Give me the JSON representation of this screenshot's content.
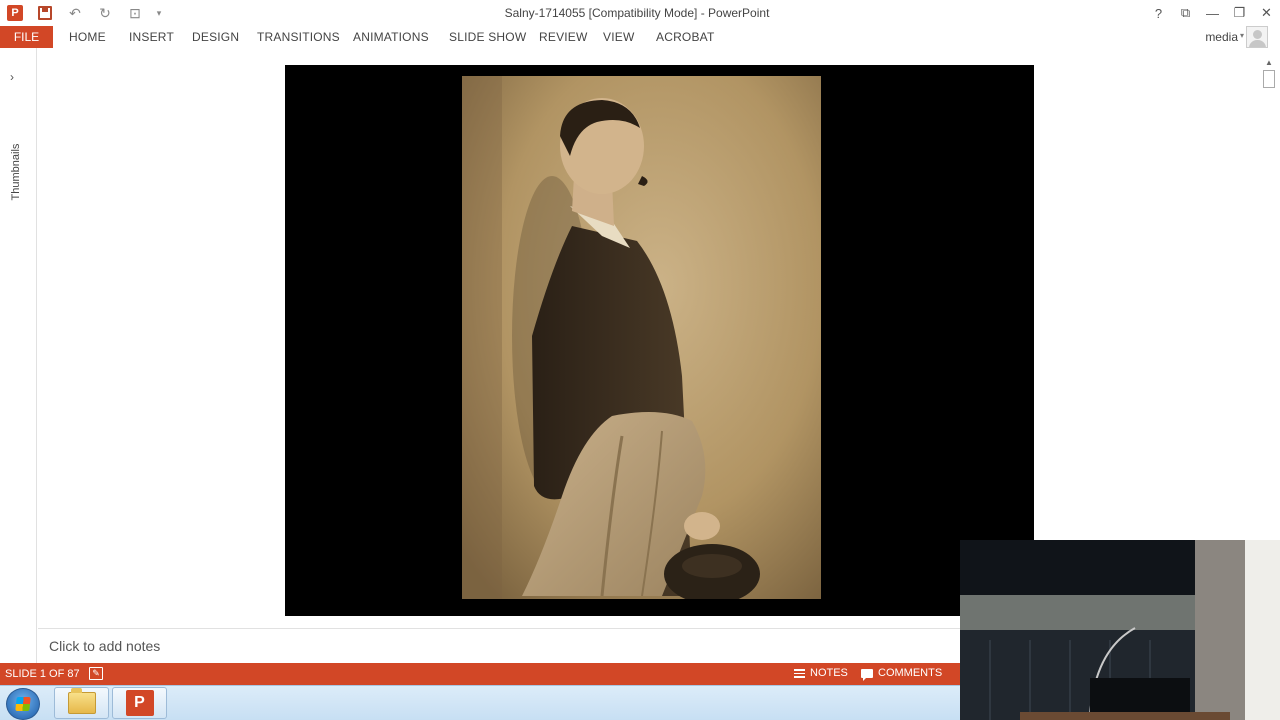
{
  "window": {
    "title": "Salny-1714055 [Compatibility Mode] - PowerPoint",
    "controls": {
      "help": "?",
      "ribbon_display": "⧉",
      "minimize": "—",
      "restore": "❐",
      "close": "✕"
    }
  },
  "quick_access": {
    "app_icon": "powerpoint-icon",
    "save": "save-icon",
    "undo": "undo-icon",
    "redo": "redo-icon",
    "start_from_beginning": "slideshow-start-icon",
    "customize": "customize-qat-icon"
  },
  "ribbon": {
    "file_label": "FILE",
    "tabs": [
      "HOME",
      "INSERT",
      "DESIGN",
      "TRANSITIONS",
      "ANIMATIONS",
      "SLIDE SHOW",
      "REVIEW",
      "VIEW",
      "ACROBAT"
    ],
    "user_name": "media"
  },
  "thumbnails_pane": {
    "label": "Thumbnails",
    "expand_icon": "chevron-right-icon"
  },
  "slide": {
    "content": "sepia portrait photograph of a man in profile wearing a dark suit, holding a coat and hat"
  },
  "notes": {
    "placeholder": "Click to add notes"
  },
  "status": {
    "slide_counter": "SLIDE 1 OF 87",
    "notes_label": "NOTES",
    "comments_label": "COMMENTS"
  },
  "taskbar": {
    "items": [
      "start-button",
      "file-explorer",
      "powerpoint"
    ]
  },
  "colors": {
    "accent": "#d24726",
    "slide_background": "#000000",
    "photo_sepia": "#b79a6b"
  }
}
